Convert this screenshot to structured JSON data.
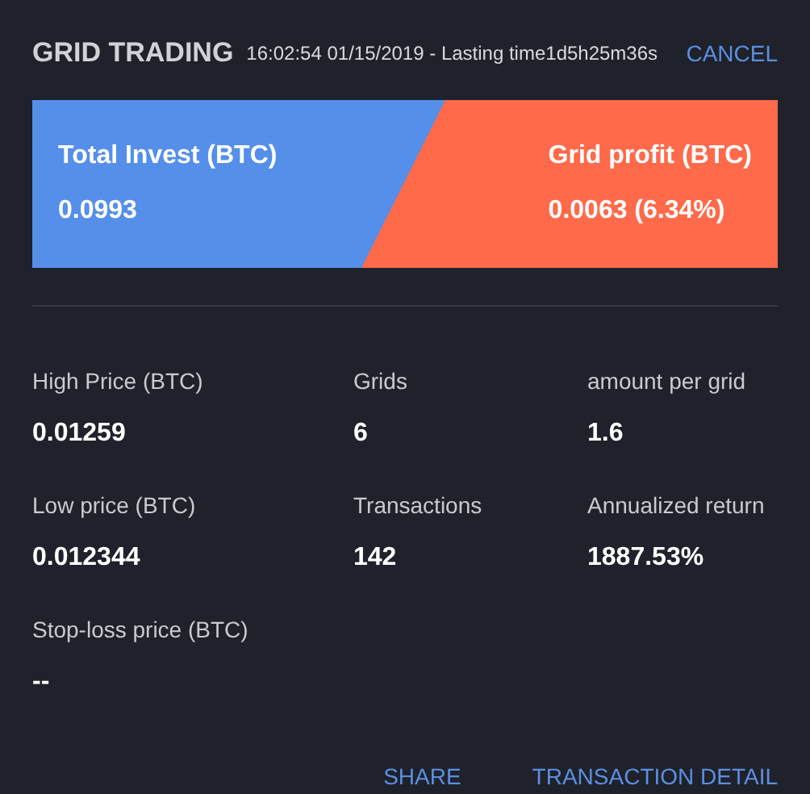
{
  "header": {
    "title": "GRID TRADING",
    "subtitle": "16:02:54 01/15/2019 - Lasting time1d5h25m36s",
    "cancel": "CANCEL"
  },
  "banner": {
    "left": {
      "label": "Total Invest (BTC)",
      "value": "0.0993"
    },
    "right": {
      "label": "Grid profit (BTC)",
      "value": "0.0063 (6.34%)"
    }
  },
  "stats": [
    {
      "label": "High Price (BTC)",
      "value": "0.01259"
    },
    {
      "label": "Grids",
      "value": "6"
    },
    {
      "label": "amount per grid",
      "value": "1.6"
    },
    {
      "label": "Low price (BTC)",
      "value": "0.012344"
    },
    {
      "label": "Transactions",
      "value": "142"
    },
    {
      "label": "Annualized return",
      "value": "1887.53%"
    },
    {
      "label": "Stop-loss price (BTC)",
      "value": "--"
    }
  ],
  "actions": [
    "SHARE",
    "TRANSACTION DETAIL"
  ]
}
